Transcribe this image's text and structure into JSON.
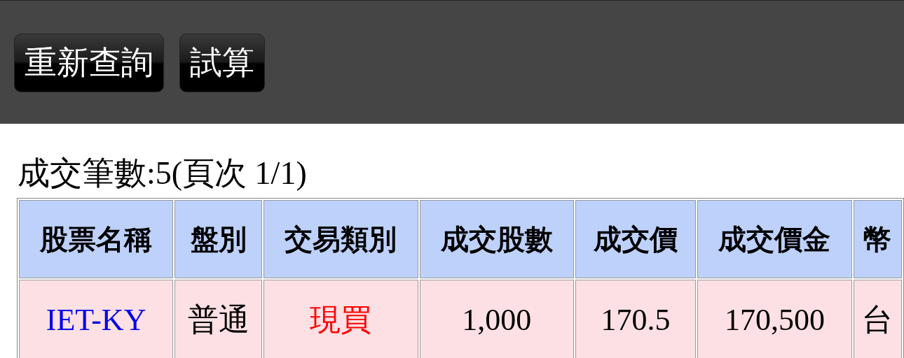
{
  "toolbar": {
    "buttons": [
      "重新查詢",
      "試算"
    ]
  },
  "summary": "成交筆數:5(頁次 1/1)",
  "table": {
    "columns": [
      "股票名稱",
      "盤別",
      "交易類別",
      "成交股數",
      "成交價",
      "成交價金",
      "幣"
    ],
    "rows": [
      [
        "IET-KY",
        "普通",
        "現買",
        "1,000",
        "170.5",
        "170,500",
        "台"
      ]
    ]
  }
}
